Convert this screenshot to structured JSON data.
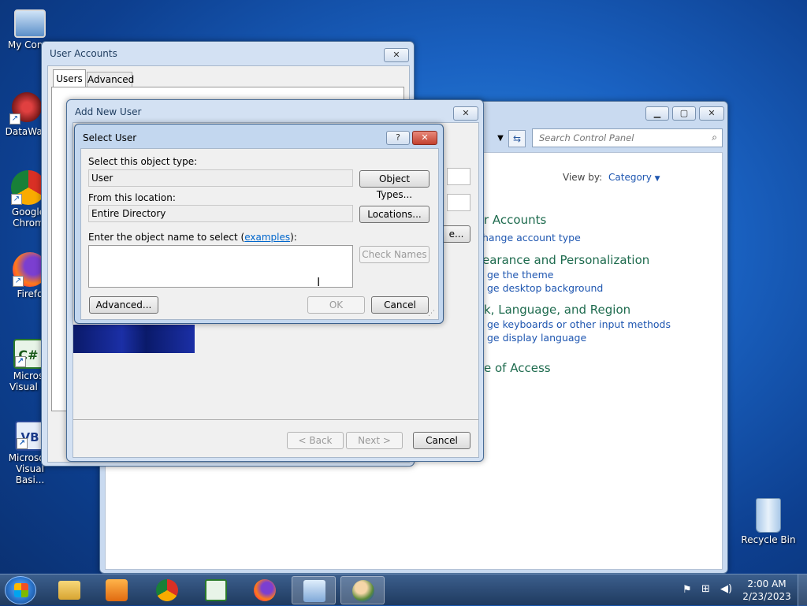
{
  "desktop": {
    "icons": [
      {
        "label": "My Comp"
      },
      {
        "label": "DataWag"
      },
      {
        "label": "Google Chrom"
      },
      {
        "label": "Firefo"
      },
      {
        "label": "Micros Visual C"
      },
      {
        "label": "Microsoft Visual Basi..."
      },
      {
        "label": "Recycle Bin"
      }
    ]
  },
  "control_panel": {
    "search_placeholder": "Search Control Panel",
    "view_by_label": "View by:",
    "view_by_value": "Category",
    "sections": [
      {
        "heading": "r Accounts",
        "links": [
          "hange account type"
        ]
      },
      {
        "heading": "earance and Personalization",
        "links": [
          "ge the theme",
          "ge desktop background"
        ]
      },
      {
        "heading": "k, Language, and Region",
        "links": [
          "ge keyboards or other input methods",
          "ge display language"
        ]
      },
      {
        "heading": "e of Access",
        "links": []
      }
    ]
  },
  "user_accounts": {
    "title": "User Accounts",
    "tabs": [
      "Users",
      "Advanced"
    ]
  },
  "add_new_user": {
    "title": "Add New User",
    "back_label": "< Back",
    "next_label": "Next >",
    "cancel_label": "Cancel",
    "ellipsis_btn": "e..."
  },
  "select_user": {
    "title": "Select User",
    "help_btn": "?",
    "object_type_label": "Select this object type:",
    "object_type_value": "User",
    "object_types_btn": "Object Types...",
    "location_label": "From this location:",
    "location_value": "Entire Directory",
    "locations_btn": "Locations...",
    "enter_name_label_pre": "Enter the object name to select (",
    "enter_name_link": "examples",
    "enter_name_label_post": "):",
    "object_name_value": "",
    "check_names_btn": "Check Names",
    "advanced_btn": "Advanced...",
    "ok_btn": "OK",
    "cancel_btn": "Cancel"
  },
  "taskbar": {
    "clock_time": "2:00 AM",
    "clock_date": "2/23/2023"
  },
  "colors": {
    "accent": "#1e56b0",
    "cp_heading": "#1e6b4e"
  }
}
